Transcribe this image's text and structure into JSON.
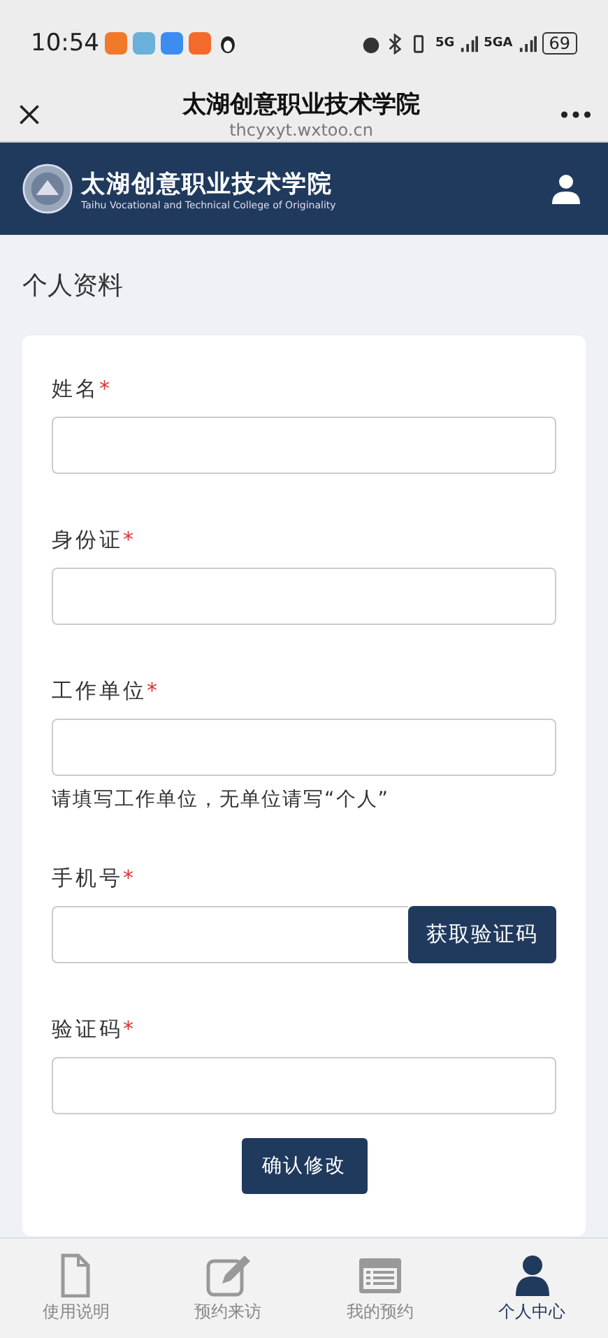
{
  "status_bar": {
    "time": "10:54",
    "network_1": "5G",
    "network_2": "5GA",
    "battery": "69"
  },
  "browser": {
    "title": "太湖创意职业技术学院",
    "url": "thcyxyt.wxtoo.cn"
  },
  "site_header": {
    "name": "太湖创意职业技术学院",
    "subtitle": "Taihu Vocational and Technical College of Originality"
  },
  "page_title": "个人资料",
  "fields": [
    {
      "kind": "text",
      "label": "姓名",
      "required_mark": "*"
    },
    {
      "kind": "text",
      "label": "身份证",
      "required_mark": "*"
    },
    {
      "kind": "text",
      "label": "工作单位",
      "required_mark": "*",
      "hint": "请填写工作单位，无单位请写“个人”"
    },
    {
      "kind": "sms",
      "label": "手机号",
      "required_mark": "*",
      "button": "获取验证码"
    },
    {
      "kind": "text",
      "label": "验证码",
      "required_mark": "*"
    }
  ],
  "submit": "确认修改",
  "tabs": [
    {
      "kind": "document",
      "label": "使用说明",
      "selected": false
    },
    {
      "kind": "edit",
      "label": "预约来访",
      "selected": false
    },
    {
      "kind": "list",
      "label": "我的预约",
      "selected": false
    },
    {
      "kind": "person",
      "label": "个人中心",
      "selected": true
    }
  ]
}
